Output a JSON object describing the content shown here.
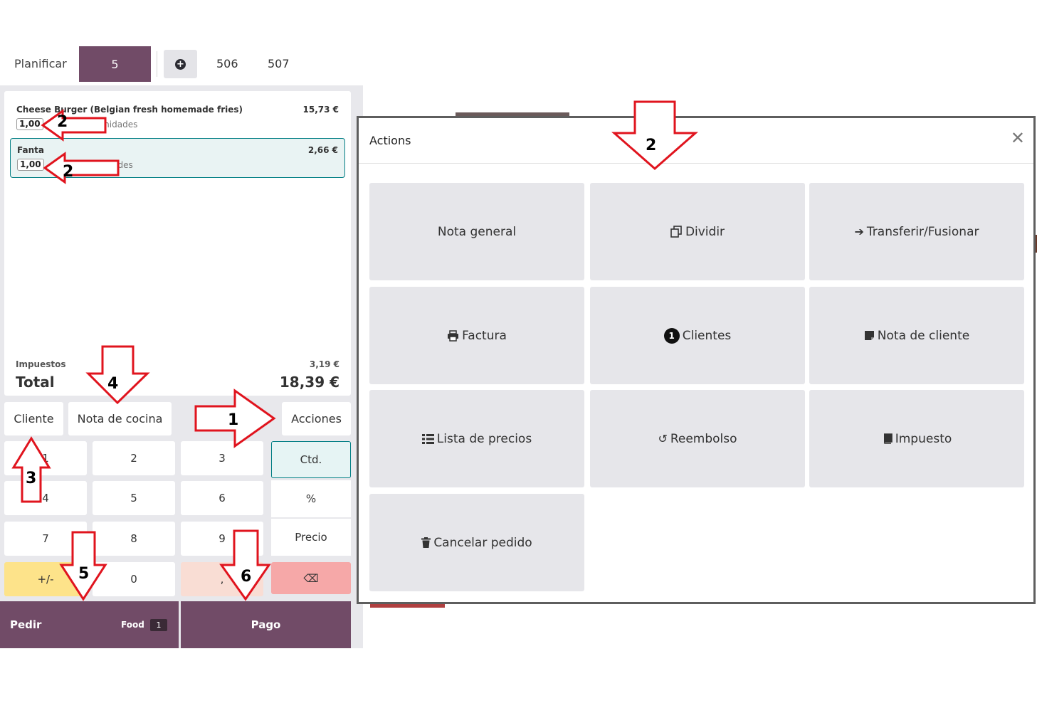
{
  "topbar": {
    "plan_label": "Planificar",
    "active_tab": "5",
    "plus_icon": "plus-circle-icon",
    "tab_506": "506",
    "tab_507": "507"
  },
  "order": {
    "lines": [
      {
        "name": "Cheese Burger (Belgian fresh homemade fries)",
        "price": "15,73 €",
        "qty": "1,00",
        "unit": "x 15,73 € / Unidades"
      },
      {
        "name": "Fanta",
        "price": "2,66 €",
        "qty": "1,00",
        "unit": "x 2,66 € / Unidades"
      }
    ],
    "tax_label": "Impuestos",
    "tax_value": "3,19 €",
    "total_label": "Total",
    "total_value": "18,39 €"
  },
  "controls": {
    "cliente": "Cliente",
    "nota_cocina": "Nota de cocina",
    "acciones": "Acciones"
  },
  "numpad": {
    "k1": "1",
    "k2": "2",
    "k3": "3",
    "k4": "4",
    "k5": "5",
    "k6": "6",
    "k7": "7",
    "k8": "8",
    "k9": "9",
    "sign": "+/-",
    "k0": "0",
    "dec": ",",
    "backspace": "⌫",
    "mode_qty": "Ctd.",
    "mode_disc": "%",
    "mode_price": "Precio"
  },
  "bottom": {
    "pedir": "Pedir",
    "food": "Food",
    "food_count": "1",
    "pago": "Pago"
  },
  "dialog": {
    "title": "Actions",
    "actions": [
      {
        "label": "Nota general",
        "icon": ""
      },
      {
        "label": "Dividir",
        "icon": "copy-icon"
      },
      {
        "label": "Transferir/Fusionar",
        "icon": "arrow-right-icon"
      },
      {
        "label": "Factura",
        "icon": "print-icon"
      },
      {
        "label": "Clientes",
        "icon": "count-badge",
        "count": "1"
      },
      {
        "label": "Nota de cliente",
        "icon": "sticky-note-icon"
      },
      {
        "label": "Lista de precios",
        "icon": "list-icon"
      },
      {
        "label": "Reembolso",
        "icon": "undo-icon"
      },
      {
        "label": "Impuesto",
        "icon": "book-icon"
      },
      {
        "label": "Cancelar pedido",
        "icon": "trash-icon"
      }
    ]
  },
  "annotations": {
    "n1": "1",
    "n2a": "2",
    "n2b": "2",
    "n2c": "2",
    "n3": "3",
    "n4": "4",
    "n5": "5",
    "n6": "6",
    "arrow_color": "#e0141e"
  },
  "colors": {
    "brand": "#714b67",
    "accent": "#017e84",
    "sign_key": "#fde38a",
    "dec_key": "#f9ddd4",
    "backspace_key": "#f6a8a8"
  }
}
